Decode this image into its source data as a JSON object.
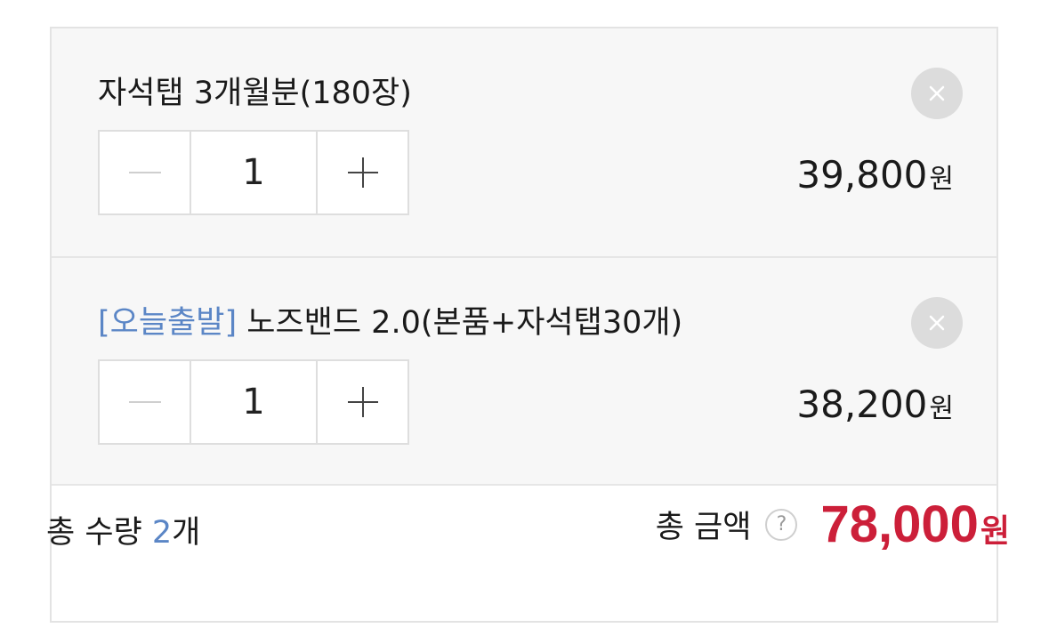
{
  "items": [
    {
      "tag": "",
      "name": "자석탭 3개월분(180장)",
      "quantity": "1",
      "price": "39,800",
      "currency": "원"
    },
    {
      "tag": "[오늘출발]",
      "name": " 노즈밴드 2.0(본품+자석탭30개)",
      "quantity": "1",
      "price": "38,200",
      "currency": "원"
    }
  ],
  "summary": {
    "total_qty_label": "총 수량 ",
    "total_qty": "2",
    "total_qty_unit": "개",
    "total_price_label": "총 금액",
    "help_symbol": "?",
    "total_price": "78,000",
    "currency": "원"
  },
  "colors": {
    "accent_blue": "#5b86c6",
    "price_red": "#cc1f39"
  }
}
